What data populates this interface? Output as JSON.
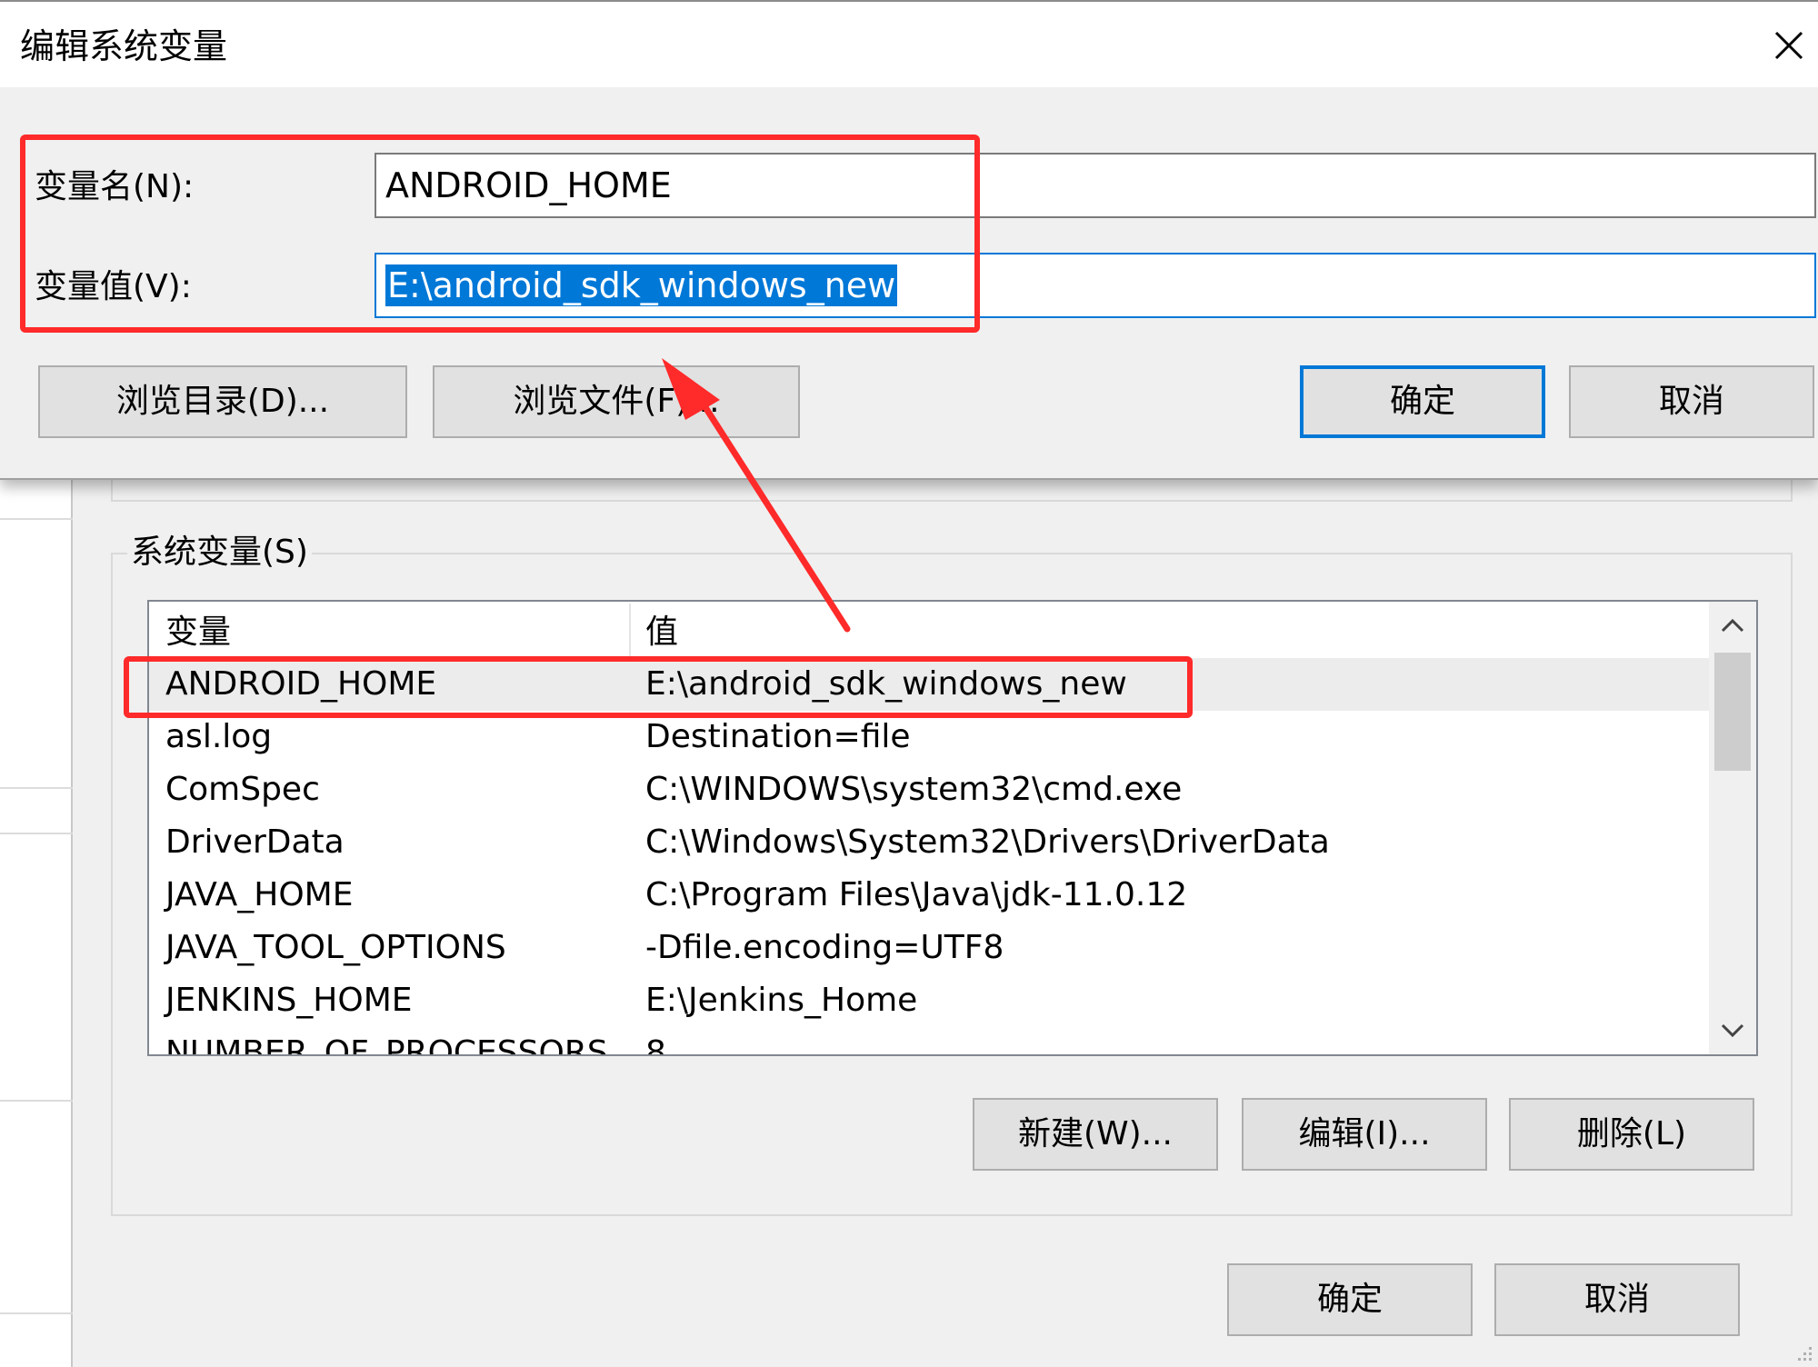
{
  "dialog": {
    "title": "编辑系统变量",
    "name_label": "变量名(N):",
    "name_value": "ANDROID_HOME",
    "value_label": "变量值(V):",
    "value_value": "E:\\android_sdk_windows_new",
    "browse_dir_button": "浏览目录(D)...",
    "browse_file_button": "浏览文件(F)...",
    "ok_button": "确定",
    "cancel_button": "取消",
    "close_icon": "close-icon"
  },
  "system_vars": {
    "legend": "系统变量(S)",
    "columns": [
      "变量",
      "值"
    ],
    "rows": [
      {
        "name": "ANDROID_HOME",
        "value": "E:\\android_sdk_windows_new"
      },
      {
        "name": "asl.log",
        "value": "Destination=file"
      },
      {
        "name": "ComSpec",
        "value": "C:\\WINDOWS\\system32\\cmd.exe"
      },
      {
        "name": "DriverData",
        "value": "C:\\Windows\\System32\\Drivers\\DriverData"
      },
      {
        "name": "JAVA_HOME",
        "value": "C:\\Program Files\\Java\\jdk-11.0.12"
      },
      {
        "name": "JAVA_TOOL_OPTIONS",
        "value": "-Dfile.encoding=UTF8"
      },
      {
        "name": "JENKINS_HOME",
        "value": "E:\\Jenkins_Home"
      },
      {
        "name": "NUMBER_OF_PROCESSORS",
        "value": "8"
      }
    ],
    "selected_row": 0,
    "new_button": "新建(W)...",
    "edit_button": "编辑(I)...",
    "delete_button": "删除(L)"
  },
  "footer": {
    "ok_button": "确定",
    "cancel_button": "取消"
  },
  "icons": {
    "scroll_up": "chevron-up-icon",
    "scroll_down": "chevron-down-icon",
    "close": "close-icon"
  },
  "colors": {
    "selection": "#0078d7",
    "annotation": "#ff2a2a",
    "dialog_bg": "#f0f0f0"
  }
}
